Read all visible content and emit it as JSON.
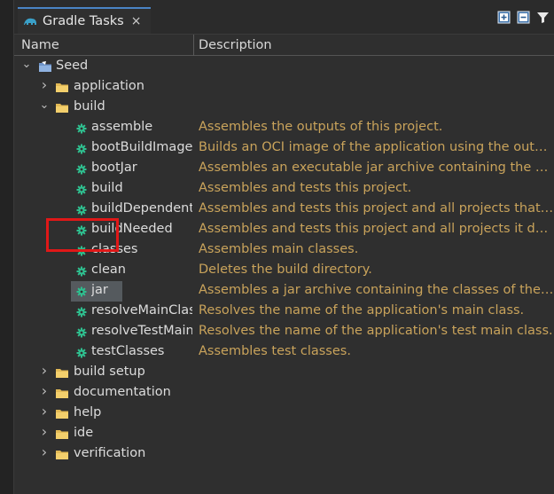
{
  "tab": {
    "title": "Gradle Tasks",
    "close_glyph": "×"
  },
  "toolbar": {
    "icons": [
      "expand-all-icon",
      "collapse-all-icon",
      "filter-icon"
    ]
  },
  "columns": {
    "name": "Name",
    "description": "Description"
  },
  "tree": {
    "root": "Seed",
    "groups_before": [
      "application"
    ],
    "build_group": "build",
    "tasks": [
      {
        "name": "assemble",
        "desc": "Assembles the outputs of this project."
      },
      {
        "name": "bootBuildImage",
        "desc": "Builds an OCI image of the application using the outpu..."
      },
      {
        "name": "bootJar",
        "desc": "Assembles an executable jar archive containing the mai..."
      },
      {
        "name": "build",
        "desc": "Assembles and tests this project."
      },
      {
        "name": "buildDependents",
        "desc": "Assembles and tests this project and all projects that de..."
      },
      {
        "name": "buildNeeded",
        "desc": "Assembles and tests this project and all projects it depe..."
      },
      {
        "name": "classes",
        "desc": "Assembles main classes."
      },
      {
        "name": "clean",
        "desc": "Deletes the build directory."
      },
      {
        "name": "jar",
        "desc": "Assembles a jar archive containing the classes of the 'm..."
      },
      {
        "name": "resolveMainClassName",
        "desc": "Resolves the name of the application's main class."
      },
      {
        "name": "resolveTestMainClassName",
        "desc": "Resolves the name of the application's test main class."
      },
      {
        "name": "testClasses",
        "desc": "Assembles test classes."
      }
    ],
    "groups_after": [
      "build setup",
      "documentation",
      "help",
      "ide",
      "verification"
    ]
  },
  "selected_task": "jar",
  "colors": {
    "accent": "#4a84c5",
    "description_text": "#c9a35b",
    "task_gear": "#2fbf8f",
    "folder": "#e2b955",
    "highlight_box": "#e01818"
  }
}
